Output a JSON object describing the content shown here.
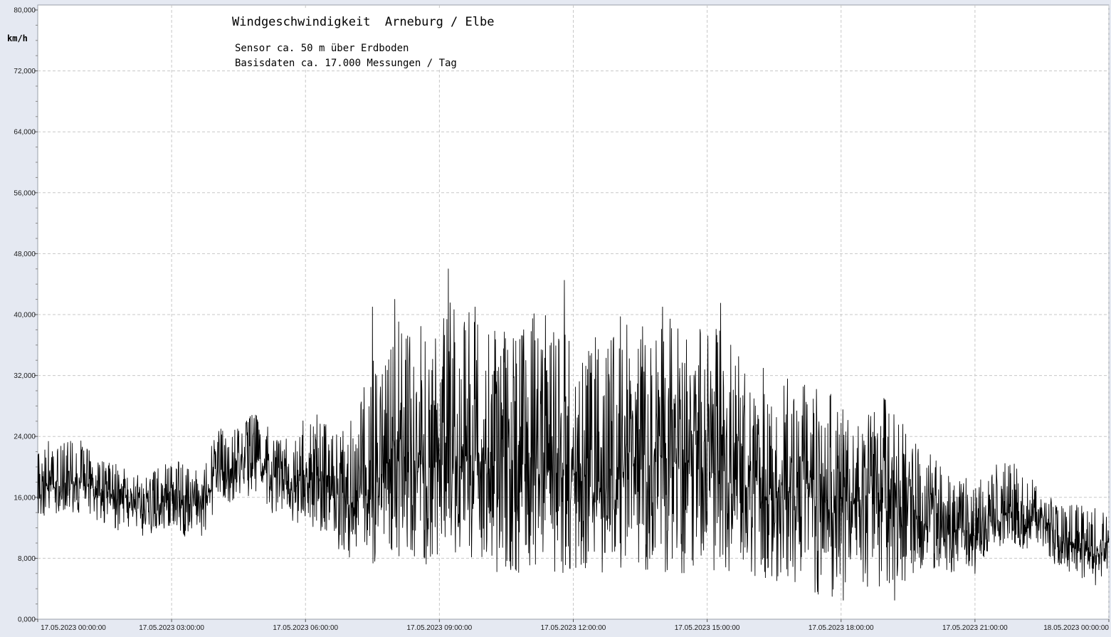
{
  "chart_data": {
    "type": "line",
    "title": "Windgeschwindigkeit  Arneburg / Elbe",
    "subtitle_lines": [
      "Sensor ca. 50 m über Erdboden",
      "Basisdaten ca. 17.000 Messungen / Tag"
    ],
    "ylabel": "km/h",
    "xlabel": "",
    "ylim": [
      0,
      80
    ],
    "yticks": [
      0,
      8,
      16,
      24,
      32,
      40,
      48,
      56,
      64,
      72,
      80
    ],
    "ytick_labels": [
      "0,000",
      "8,000",
      "16,000",
      "24,000",
      "32,000",
      "40,000",
      "48,000",
      "56,000",
      "64,000",
      "72,000",
      "80,000"
    ],
    "xlim_hours": [
      0,
      24
    ],
    "xticks_hours": [
      0,
      3,
      6,
      9,
      12,
      15,
      18,
      21,
      24
    ],
    "xtick_labels": [
      "17.05.2023  00:00:00",
      "17.05.2023  03:00:00",
      "17.05.2023  06:00:00",
      "17.05.2023  09:00:00",
      "17.05.2023  12:00:00",
      "17.05.2023  15:00:00",
      "17.05.2023  18:00:00",
      "17.05.2023  21:00:00",
      "18.05.2023  00:00:00"
    ],
    "grid": true,
    "minor_y_step": 2,
    "series": [
      {
        "hour": [
          0,
          0.25,
          0.5,
          0.75,
          1,
          1.25,
          1.5,
          1.75,
          2,
          2.25,
          2.5,
          2.75,
          3,
          3.25,
          3.5,
          3.75,
          4,
          4.25,
          4.5,
          4.75,
          5,
          5.25,
          5.5,
          5.75,
          6,
          6.25,
          6.5,
          6.75,
          7,
          7.25,
          7.5,
          7.75,
          8,
          8.25,
          8.5,
          8.75,
          9,
          9.25,
          9.5,
          9.75,
          10,
          10.25,
          10.5,
          10.75,
          11,
          11.25,
          11.5,
          11.75,
          12,
          12.25,
          12.5,
          12.75,
          13,
          13.25,
          13.5,
          13.75,
          14,
          14.25,
          14.5,
          14.75,
          15,
          15.25,
          15.5,
          15.75,
          16,
          16.25,
          16.5,
          16.75,
          17,
          17.25,
          17.5,
          17.75,
          18,
          18.25,
          18.5,
          18.75,
          19,
          19.25,
          19.5,
          19.75,
          20,
          20.25,
          20.5,
          20.75,
          21,
          21.25,
          21.5,
          21.75,
          22,
          22.25,
          22.5,
          22.75,
          23,
          23.25,
          23.5,
          23.75,
          24
        ],
        "mean": [
          16,
          18,
          17.5,
          18,
          18.5,
          17,
          16.5,
          15.5,
          15.5,
          14.5,
          14,
          15,
          16,
          15.5,
          14.5,
          15,
          20,
          19.5,
          20,
          20.5,
          20.5,
          19,
          18,
          17.5,
          19,
          18.5,
          17,
          15,
          15,
          17,
          18,
          19,
          24,
          23,
          22,
          21,
          21,
          20.5,
          20,
          22,
          21,
          20,
          21.5,
          19,
          20,
          19.5,
          20,
          20,
          19,
          18,
          19,
          18,
          20,
          22,
          21,
          20,
          22,
          21,
          20,
          19.5,
          20.5,
          20,
          19.5,
          18,
          17.5,
          18,
          17,
          17,
          16,
          17,
          16,
          15,
          15.5,
          15.5,
          16,
          17,
          17,
          16.5,
          16,
          13,
          12,
          12.5,
          11.5,
          11,
          11,
          12,
          13,
          14,
          13.5,
          13,
          13,
          12,
          10,
          10,
          9.5,
          9.5,
          10
        ],
        "low": [
          13,
          14,
          13.5,
          14,
          14,
          13.5,
          12,
          11.5,
          12,
          11,
          10.5,
          11,
          12,
          11,
          10,
          11,
          15,
          15,
          15.5,
          16,
          16,
          14,
          13,
          12.5,
          12,
          11.5,
          10,
          9,
          8,
          7,
          7,
          8,
          8,
          7,
          7,
          7,
          7,
          8,
          8,
          8,
          7,
          6,
          6,
          6,
          6,
          6,
          6,
          6,
          6,
          6,
          6,
          6,
          6,
          6,
          6,
          6,
          6,
          6,
          6,
          6,
          6,
          6,
          6,
          6,
          6,
          5,
          5,
          5,
          4,
          4,
          3,
          4,
          3,
          4,
          4,
          4,
          4,
          4,
          5,
          6,
          6,
          6,
          6,
          7,
          7,
          8,
          9,
          10,
          9,
          9,
          8,
          7,
          6,
          6,
          5,
          5,
          5
        ],
        "high": [
          23,
          24,
          23,
          23.5,
          24,
          22,
          21,
          20.5,
          20,
          19.5,
          19,
          20,
          21,
          20.5,
          19.5,
          20,
          25,
          25,
          26,
          27,
          27,
          25,
          24,
          24,
          27,
          27,
          26,
          24,
          26,
          30,
          35,
          37,
          41,
          40,
          39,
          38,
          40,
          42,
          41,
          40,
          38,
          38,
          38,
          37,
          40,
          42,
          38,
          38,
          37,
          36,
          38,
          39,
          40,
          41,
          40,
          38,
          39,
          40,
          39,
          37,
          40,
          38,
          37,
          36,
          34,
          34,
          33,
          32,
          31,
          31,
          32,
          30,
          28,
          28,
          27,
          28,
          30,
          28,
          26,
          24,
          22,
          21,
          19,
          19,
          19,
          20,
          21,
          21,
          20,
          19,
          18,
          16,
          16,
          15,
          15,
          15,
          15
        ]
      }
    ],
    "peaks": [
      {
        "hour": 7.5,
        "value": 41
      },
      {
        "hour": 8.0,
        "value": 42
      },
      {
        "hour": 9.2,
        "value": 46
      },
      {
        "hour": 9.8,
        "value": 41
      },
      {
        "hour": 11.8,
        "value": 44.5
      },
      {
        "hour": 14.0,
        "value": 41
      },
      {
        "hour": 15.3,
        "value": 41.5
      }
    ],
    "troughs": [
      {
        "hour": 17.8,
        "value": 3
      },
      {
        "hour": 18.05,
        "value": 2.5
      },
      {
        "hour": 19.2,
        "value": 2.5
      },
      {
        "hour": 21.0,
        "value": 6
      },
      {
        "hour": 23.7,
        "value": 4.5
      }
    ],
    "colors": {
      "line": "#000000",
      "plot_background": "#ffffff",
      "frame_background": "#e5e9f2",
      "grid": "#c8c8c8"
    }
  }
}
